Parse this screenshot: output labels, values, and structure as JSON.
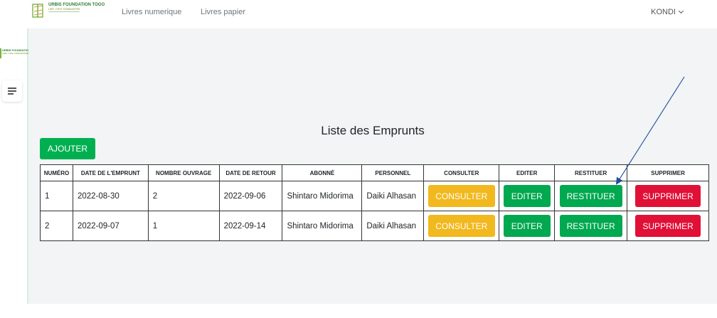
{
  "header": {
    "brand_name": "URBIS FOUNDATION TOGO",
    "brand_tagline": "LIRE, C'EST S'EMANCIPER",
    "nav_links": [
      "Livres numerique",
      "Livres papier"
    ],
    "user_name": "KONDI"
  },
  "sidebar": {
    "logo_name": "URBIS FOUNDATION TOGO",
    "logo_tagline": "LIRE, C'EST S'EMANCIPER"
  },
  "main": {
    "title": "Liste des Emprunts",
    "add_button": "AJOUTER",
    "table": {
      "headers": [
        "NUMÉRO",
        "DATE DE L'EMPRUNT",
        "NOMBRE OUVRAGE",
        "DATE DE RETOUR",
        "ABONNÉ",
        "PERSONNEL",
        "CONSULTER",
        "EDITER",
        "RESTITUER",
        "SUPPRIMER"
      ],
      "rows": [
        {
          "numero": "1",
          "date_emprunt": "2022-08-30",
          "nombre_ouvrage": "2",
          "date_retour": "2022-09-06",
          "abonne": "Shintaro Midorima",
          "personnel": "Daiki Alhasan"
        },
        {
          "numero": "2",
          "date_emprunt": "2022-09-07",
          "nombre_ouvrage": "1",
          "date_retour": "2022-09-14",
          "abonne": "Shintaro Midorima",
          "personnel": "Daiki Alhasan"
        }
      ],
      "action_labels": {
        "consulter": "CONSULTER",
        "editer": "EDITER",
        "restituer": "RESTITUER",
        "supprimer": "SUPPRIMER"
      }
    }
  },
  "colors": {
    "green": "#00a84f",
    "yellow": "#f2b81f",
    "red": "#e01036",
    "annotation_arrow": "#1f4e9a"
  }
}
